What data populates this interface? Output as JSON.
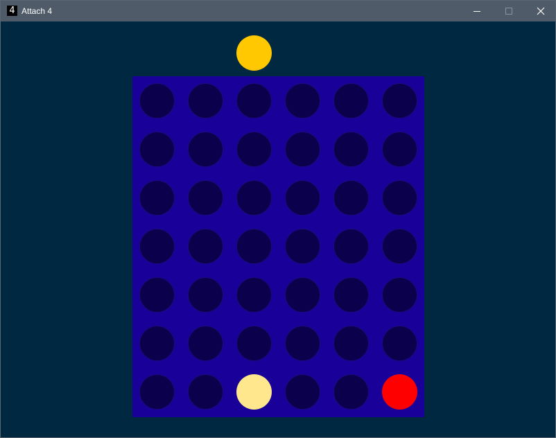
{
  "window": {
    "title": "Attach 4",
    "icon_glyph": "4"
  },
  "colors": {
    "background": "#002841",
    "board": "#190099",
    "empty": "#0b004b",
    "empty_border": "#1a0a7a",
    "yellow": "#ffc800",
    "light_yellow": "#ffe78e",
    "red": "#ff0000"
  },
  "preview_piece": {
    "column": 2,
    "color": "yellow"
  },
  "board": {
    "columns": 6,
    "rows": 7,
    "grid": [
      [
        "empty",
        "empty",
        "empty",
        "empty",
        "empty",
        "empty"
      ],
      [
        "empty",
        "empty",
        "empty",
        "empty",
        "empty",
        "empty"
      ],
      [
        "empty",
        "empty",
        "empty",
        "empty",
        "empty",
        "empty"
      ],
      [
        "empty",
        "empty",
        "empty",
        "empty",
        "empty",
        "empty"
      ],
      [
        "empty",
        "empty",
        "empty",
        "empty",
        "empty",
        "empty"
      ],
      [
        "empty",
        "empty",
        "empty",
        "empty",
        "empty",
        "empty"
      ],
      [
        "empty",
        "empty",
        "light_yellow",
        "empty",
        "empty",
        "red"
      ]
    ]
  }
}
